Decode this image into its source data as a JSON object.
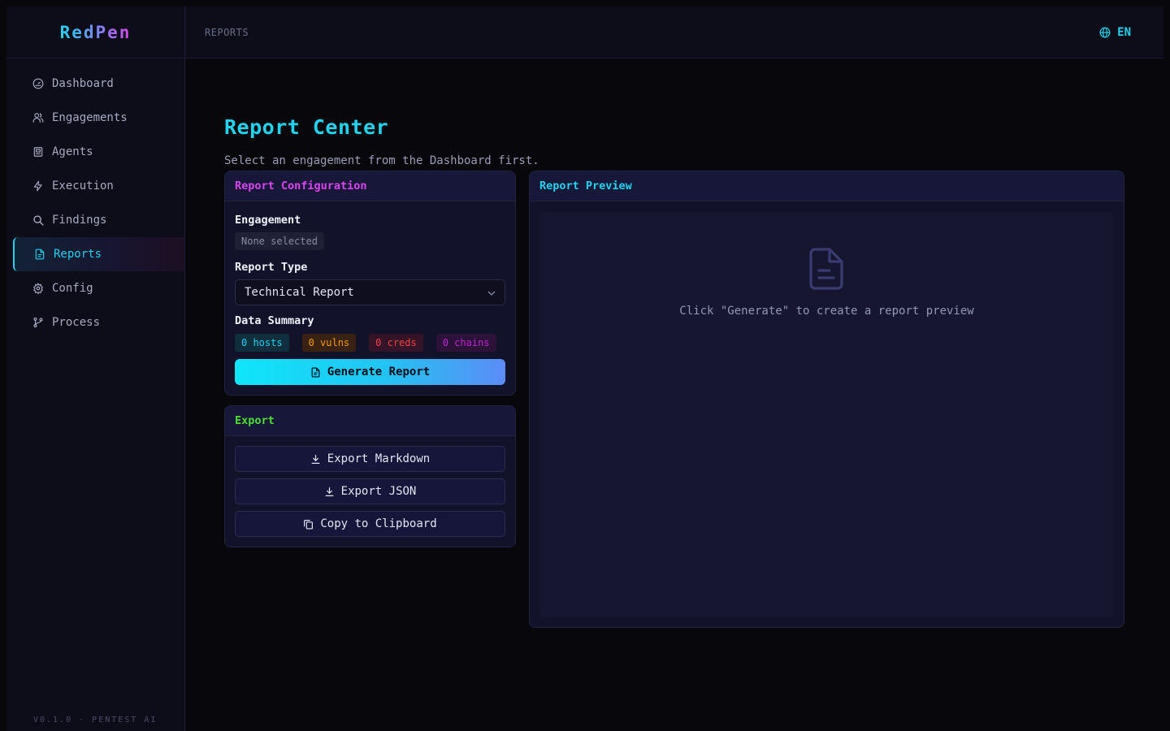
{
  "app": {
    "name": "RedPen",
    "version": "V0.1.0 · PENTEST AI"
  },
  "topbar": {
    "breadcrumb": "REPORTS",
    "language": "EN"
  },
  "sidebar": {
    "items": [
      {
        "label": "Dashboard",
        "icon": "gauge-icon"
      },
      {
        "label": "Engagements",
        "icon": "users-icon"
      },
      {
        "label": "Agents",
        "icon": "bot-icon"
      },
      {
        "label": "Execution",
        "icon": "zap-icon"
      },
      {
        "label": "Findings",
        "icon": "search-icon"
      },
      {
        "label": "Reports",
        "icon": "file-text-icon",
        "active": true
      },
      {
        "label": "Config",
        "icon": "gear-icon"
      },
      {
        "label": "Process",
        "icon": "git-branch-icon"
      }
    ]
  },
  "page": {
    "title": "Report Center",
    "subtitle": "Select an engagement from the Dashboard first."
  },
  "config": {
    "header": "Report Configuration",
    "engagement_label": "Engagement",
    "engagement_value": "None selected",
    "report_type_label": "Report Type",
    "report_type_value": "Technical Report",
    "data_summary_label": "Data Summary",
    "stats": {
      "hosts": "0 hosts",
      "vulns": "0 vulns",
      "creds": "0 creds",
      "chains": "0 chains"
    },
    "generate_label": "Generate Report"
  },
  "export": {
    "header": "Export",
    "markdown_label": "Export Markdown",
    "json_label": "Export JSON",
    "clipboard_label": "Copy to Clipboard"
  },
  "preview": {
    "header": "Report Preview",
    "empty_message": "Click \"Generate\" to create a report preview"
  },
  "colors": {
    "accent_cyan": "#22d3ee",
    "accent_magenta": "#d946ef",
    "accent_green": "#4ade2f",
    "stat_hosts": "#22d3ee",
    "stat_vulns": "#f59e0b",
    "stat_creds": "#ef4444",
    "stat_chains": "#c026d3"
  }
}
